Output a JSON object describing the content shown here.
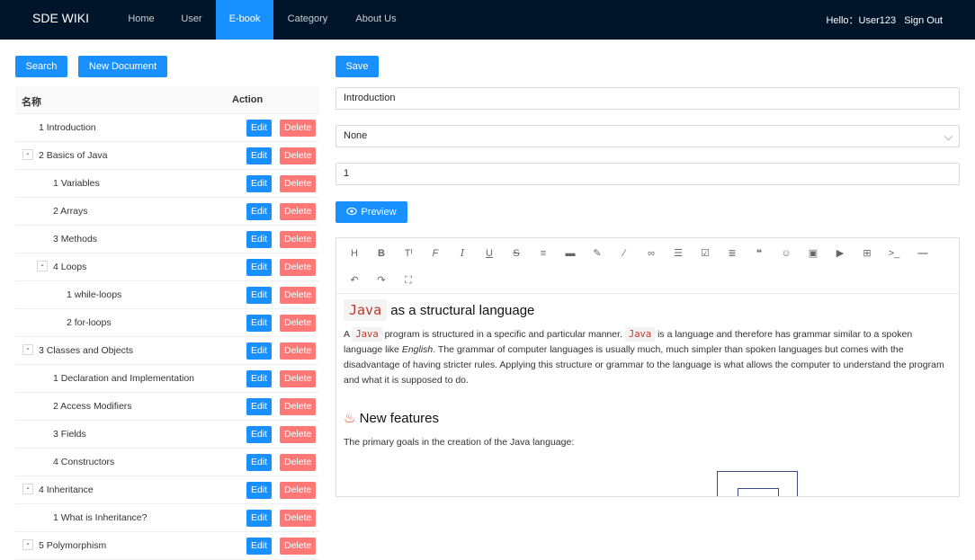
{
  "header": {
    "logo": "SDE WIKI",
    "nav": [
      "Home",
      "User",
      "E-book",
      "Category",
      "About Us"
    ],
    "active_nav": "E-book",
    "greeting": "Hello：User123",
    "sign_out": "Sign Out"
  },
  "left": {
    "search_label": "Search",
    "new_doc_label": "New Document",
    "col_name": "名称",
    "col_action": "Action",
    "edit_label": "Edit",
    "delete_label": "Delete",
    "rows": [
      {
        "label": "1 Introduction",
        "toggle": ""
      },
      {
        "label": "2 Basics of Java",
        "toggle": "-"
      },
      {
        "label": "1 Variables",
        "toggle": ""
      },
      {
        "label": "2 Arrays",
        "toggle": ""
      },
      {
        "label": "3 Methods",
        "toggle": ""
      },
      {
        "label": "4 Loops",
        "toggle": "-"
      },
      {
        "label": "1 while-loops",
        "toggle": ""
      },
      {
        "label": "2 for-loops",
        "toggle": ""
      },
      {
        "label": "3 Classes and Objects",
        "toggle": "-"
      },
      {
        "label": "1 Declaration and Implementation",
        "toggle": ""
      },
      {
        "label": "2 Access Modifiers",
        "toggle": ""
      },
      {
        "label": "3 Fields",
        "toggle": ""
      },
      {
        "label": "4 Constructors",
        "toggle": ""
      },
      {
        "label": "4 Inheritance",
        "toggle": "-"
      },
      {
        "label": "1 What is Inheritance?",
        "toggle": ""
      },
      {
        "label": "5 Polymorphism",
        "toggle": "-"
      }
    ]
  },
  "right": {
    "save_label": "Save",
    "name_value": "Introduction",
    "parent_value": "None",
    "sort_value": "1",
    "preview_label": "Preview"
  },
  "editor": {
    "toolbar_icons": [
      "heading-icon",
      "bold-icon",
      "text-height-icon",
      "font-icon",
      "italic-icon",
      "underline-icon",
      "strikethrough-icon",
      "indent-icon",
      "align-icon",
      "highlight-icon",
      "brush-icon",
      "link-icon",
      "list-icon",
      "checkbox-icon",
      "align-left-icon",
      "quote-icon",
      "emoji-icon",
      "image-icon",
      "video-icon",
      "table-icon",
      "terminal-icon",
      "hr-icon",
      "undo-icon",
      "redo-icon",
      "fullscreen-icon"
    ],
    "h1_code": "Java",
    "h1_text": "as a structural language",
    "p1_a": "A",
    "p1_code1": "Java",
    "p1_b": "program is structured in a specific and particular manner.",
    "p1_code2": "Java",
    "p1_c": "is a language and therefore has grammar similar to a spoken language like",
    "p1_em": "English",
    "p1_d": ". The grammar of computer languages is usually much, much simpler than spoken languages but comes with the disadvantage of having stricter rules. Applying this structure or grammar to the language is what allows the computer to understand the program and what it is supposed to do.",
    "h2_icon": "♨",
    "h2_text": "New features",
    "p2": "The primary goals in the creation of the Java language:"
  },
  "colors": {
    "header_bg": "#001529",
    "primary": "#1890ff",
    "danger": "#ff7875"
  }
}
